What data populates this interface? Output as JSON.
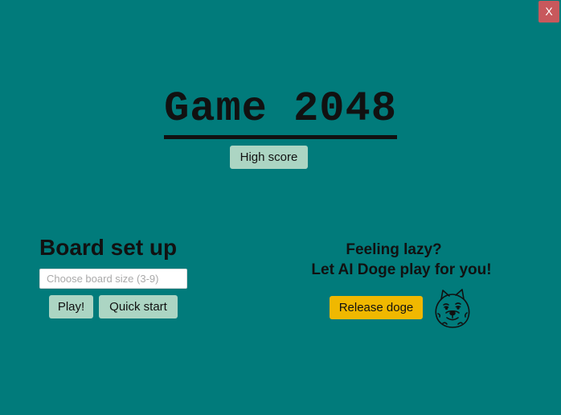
{
  "window": {
    "close_label": "X"
  },
  "header": {
    "title": "Game 2048",
    "high_score_label": "High score"
  },
  "board_setup": {
    "heading": "Board set up",
    "size_input": {
      "placeholder": "Choose board size (3-9)",
      "value": ""
    },
    "play_label": "Play!",
    "quick_start_label": "Quick start"
  },
  "ai_panel": {
    "line1": "Feeling lazy?",
    "line2": "Let AI Doge play for you!",
    "release_label": "Release doge",
    "icon": "doge-icon"
  },
  "colors": {
    "background": "#017b7b",
    "button": "#acd5c3",
    "accent_button": "#f0b800",
    "close_button": "#c8585c"
  }
}
